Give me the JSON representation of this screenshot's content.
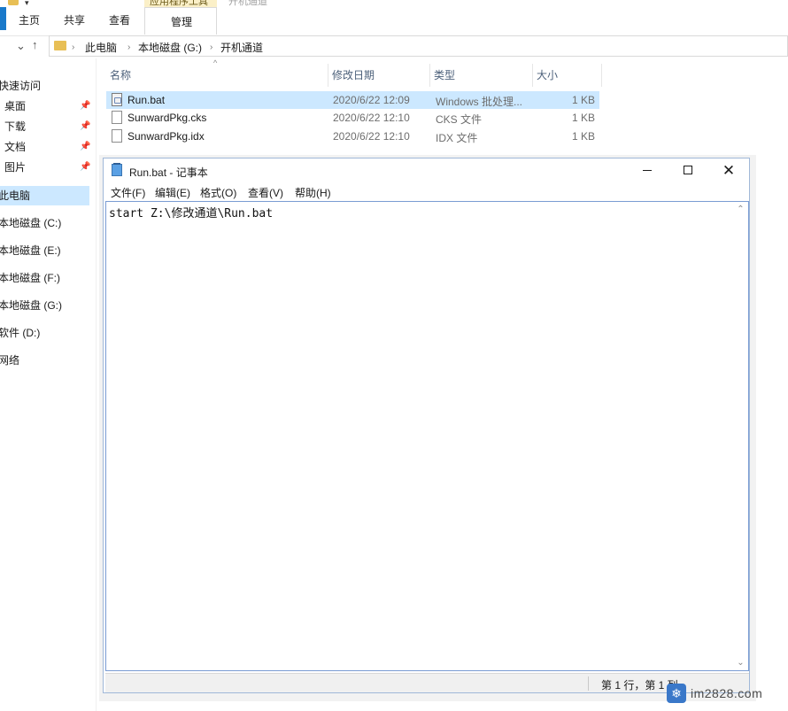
{
  "explorer": {
    "ribbon": {
      "tabs": [
        "主页",
        "共享",
        "查看"
      ],
      "context_tab_group": "应用程序工具",
      "context_tab": "管理",
      "window_title": "开机通道"
    },
    "address": {
      "parts": [
        "此电脑",
        "本地磁盘 (G:)",
        "开机通道"
      ]
    },
    "sidebar": {
      "items": [
        {
          "label": "快速访问"
        },
        {
          "label": "桌面"
        },
        {
          "label": "下载"
        },
        {
          "label": "文档"
        },
        {
          "label": "图片"
        },
        {
          "label": "此电脑"
        },
        {
          "label": "本地磁盘 (C:)"
        },
        {
          "label": "本地磁盘 (E:)"
        },
        {
          "label": "本地磁盘 (F:)"
        },
        {
          "label": "本地磁盘 (G:)"
        },
        {
          "label": "软件 (D:)"
        },
        {
          "label": "网络"
        }
      ]
    },
    "columns": {
      "name": "名称",
      "date": "修改日期",
      "type": "类型",
      "size": "大小"
    },
    "files": [
      {
        "name": "Run.bat",
        "date": "2020/6/22 12:09",
        "type": "Windows 批处理...",
        "size": "1 KB",
        "icon": "bat-file-icon"
      },
      {
        "name": "SunwardPkg.cks",
        "date": "2020/6/22 12:10",
        "type": "CKS 文件",
        "size": "1 KB",
        "icon": "blank-file-icon"
      },
      {
        "name": "SunwardPkg.idx",
        "date": "2020/6/22 12:10",
        "type": "IDX 文件",
        "size": "1 KB",
        "icon": "blank-file-icon"
      }
    ]
  },
  "notepad": {
    "title": "Run.bat - 记事本",
    "menu": [
      "文件(F)",
      "编辑(E)",
      "格式(O)",
      "查看(V)",
      "帮助(H)"
    ],
    "content": "start Z:\\修改通道\\Run.bat",
    "status": "第 1 行，第 1 列"
  },
  "watermark": {
    "text": "im2828.com"
  },
  "colors": {
    "selection": "#cce8ff",
    "accent": "#1979ca",
    "folder": "#e8bf55"
  }
}
